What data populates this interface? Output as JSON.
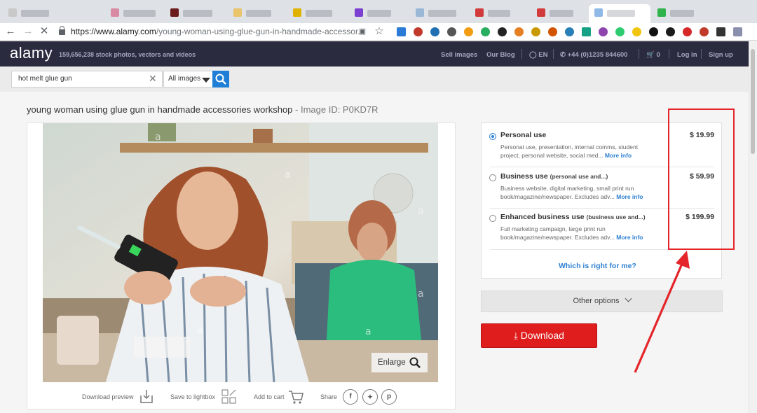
{
  "browser": {
    "url_host": "https://www.alamy.com",
    "url_path": "/young-woman-using-glue-gun-in-handmade-accessor..."
  },
  "header": {
    "logo": "alamy",
    "tagline": "159,656,238 stock photos, vectors and videos",
    "nav": {
      "sell": "Sell images",
      "blog": "Our Blog",
      "lang": "EN",
      "phone": "+44 (0)1235 844600",
      "cart_count": "0",
      "login": "Log in",
      "signup": "Sign up"
    }
  },
  "search": {
    "query": "hot melt glue gun",
    "filter": "All images"
  },
  "image": {
    "title": "young woman using glue gun in handmade accessories workshop",
    "id_label": " - Image ID: P0KD7R",
    "enlarge": "Enlarge"
  },
  "actions": {
    "preview": "Download preview",
    "lightbox": "Save to lightbox",
    "cart": "Add to cart",
    "share": "Share"
  },
  "pricing": {
    "options": [
      {
        "name": "Personal use",
        "sub": "",
        "desc": "Personal use, presentation, internal comms, student project, personal website, social med...",
        "more": "More info",
        "price": "$ 19.99",
        "selected": true
      },
      {
        "name": "Business use",
        "sub": "(personal use and...)",
        "desc": "Business website, digital marketing, small print run book/magazine/newspaper. Excludes adv...",
        "more": "More info",
        "price": "$ 59.99",
        "selected": false
      },
      {
        "name": "Enhanced business use",
        "sub": "(business use and...)",
        "desc": "Full marketing campaign, large print run book/magazine/newspaper. Excludes adv...",
        "more": "More info",
        "price": "$ 199.99",
        "selected": false
      }
    ],
    "which_link": "Which is right for me?",
    "other_options": "Other options",
    "download": "Download"
  },
  "colors": {
    "header_bg": "#2b2b40",
    "accent_blue": "#2d7fd1",
    "download_red": "#df1d1d",
    "annotation_red": "#e4262b"
  },
  "icons": [
    "back-arrow-icon",
    "forward-arrow-icon",
    "stop-icon",
    "lock-icon",
    "star-icon",
    "globe-icon",
    "phone-icon",
    "cart-icon",
    "search-icon",
    "clear-icon",
    "download-icon",
    "lightbox-icon",
    "facebook-icon",
    "twitter-icon",
    "pinterest-icon",
    "chevron-down-icon",
    "zoom-icon"
  ]
}
